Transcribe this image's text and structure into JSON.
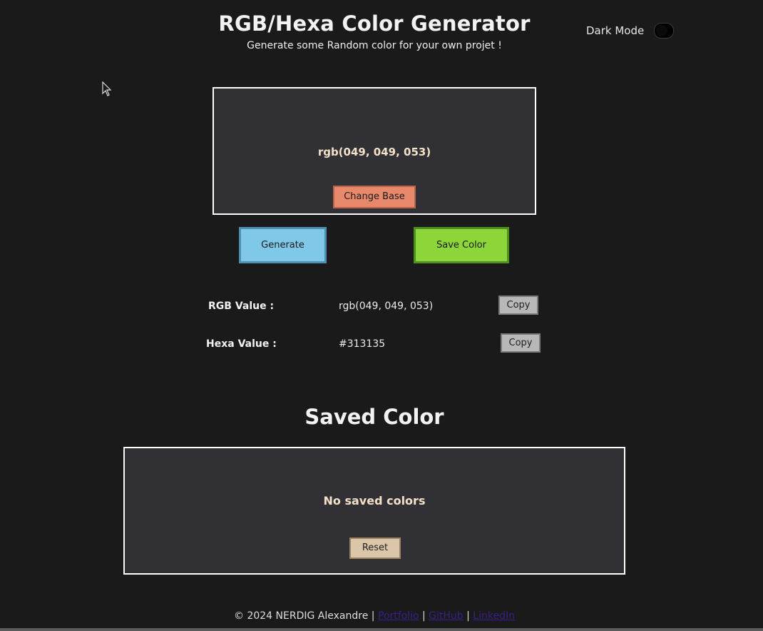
{
  "header": {
    "title": "RGB/Hexa Color Generator",
    "subtitle": "Generate some Random color for your own projet !",
    "dark_mode_label": "Dark Mode"
  },
  "preview": {
    "color_value": "rgb(049, 049, 053)",
    "change_base_label": "Change Base",
    "background_color": "#313135"
  },
  "actions": {
    "generate_label": "Generate",
    "save_label": "Save Color"
  },
  "values": {
    "rgb_label": "RGB Value :",
    "rgb_value": "rgb(049, 049, 053)",
    "hexa_label": "Hexa Value :",
    "hexa_value": "#313135",
    "copy_label": "Copy"
  },
  "saved": {
    "title": "Saved Color",
    "empty_text": "No saved colors",
    "reset_label": "Reset"
  },
  "footer": {
    "copyright": "© 2024 NERDIG Alexandre",
    "separator": "|",
    "links": [
      "Portfolio",
      "GitHub",
      "LinkedIn"
    ]
  },
  "colors": {
    "background": "#1a1a1a",
    "panel": "#313135",
    "change_base": "#e8896b",
    "generate": "#7fc8e8",
    "save": "#8dd63a",
    "copy": "#b8b8b8",
    "reset": "#dcc6aa",
    "accent_text": "#f2e0c8"
  },
  "icons": {
    "cursor": "mouse-pointer-icon",
    "toggle": "dark-mode-toggle"
  }
}
